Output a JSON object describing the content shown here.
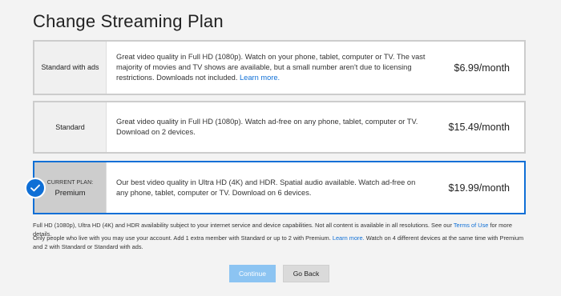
{
  "page": {
    "title": "Change Streaming Plan"
  },
  "plans": [
    {
      "name": "Standard with ads",
      "description": "Great video quality in Full HD (1080p). Watch on your phone, tablet, computer or TV. The vast majority of movies and TV shows are available, but a small number aren't due to licensing restrictions. Downloads not included.",
      "link": "Learn more.",
      "price": "$6.99/month"
    },
    {
      "name": "Standard",
      "description": "Great video quality in Full HD (1080p). Watch ad-free on any phone, tablet, computer or TV. Download on 2 devices.",
      "price": "$15.49/month"
    },
    {
      "current_label": "CURRENT PLAN:",
      "name": "Premium",
      "description": "Our best video quality in Ultra HD (4K) and HDR. Spatial audio available. Watch ad-free on any phone, tablet, computer or TV. Download on 6 devices.",
      "price": "$19.99/month",
      "selected": true
    }
  ],
  "footnotes": {
    "line1_prefix": "Full HD (1080p), Ultra HD (4K) and HDR availability subject to your internet service and device capabilities. Not all content is available in all resolutions. See our",
    "line1_link": "Terms of Use",
    "line1_suffix": "for more details.",
    "line2_prefix": "Only people who live with you may use your account. Add 1 extra member with Standard or up to 2 with Premium.",
    "line2_link": "Learn more.",
    "line2_suffix": "Watch on 4 different devices at the same time with Premium and 2 with Standard or Standard with ads."
  },
  "buttons": {
    "continue": "Continue",
    "back": "Go Back"
  },
  "colors": {
    "accent": "#0f6fd6",
    "continue_bg": "#8cc4f2"
  },
  "icons": {
    "selected": "checkmark-icon"
  }
}
